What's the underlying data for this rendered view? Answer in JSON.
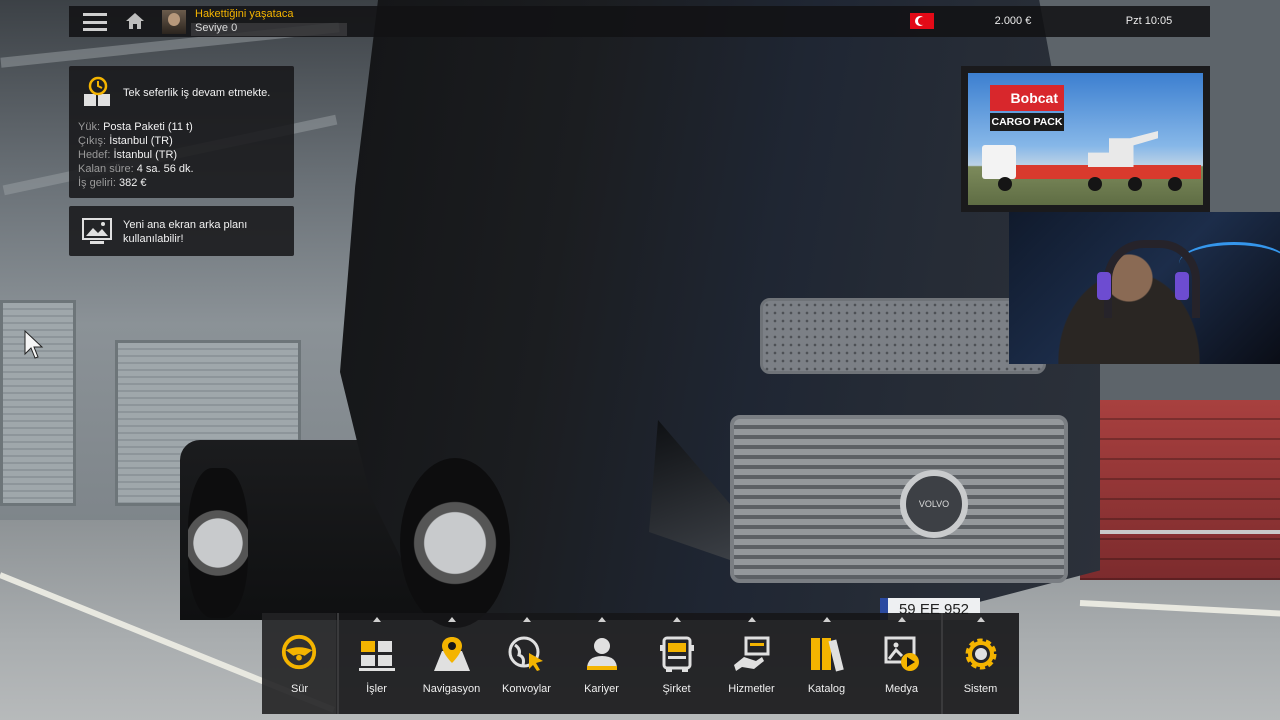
{
  "colors": {
    "accent": "#f4b400",
    "panel_bg": "#161618",
    "text": "#f2f2f2"
  },
  "topbar": {
    "menu_icon": "hamburger-icon",
    "home_icon": "home-icon",
    "player_name": "Hakettiğini yaşataca",
    "player_level": "Seviye 0",
    "flag": "turkey-flag",
    "money": "2.000 €",
    "clock": "Pzt 10:05"
  },
  "job_panel": {
    "icon": "clock-cargo-icon",
    "title": "Tek seferlik iş devam etmekte.",
    "rows": [
      {
        "key": "Yük:",
        "value": "Posta Paketi (11 t)"
      },
      {
        "key": "Çıkış:",
        "value": "İstanbul (TR)"
      },
      {
        "key": "Hedef:",
        "value": "İstanbul (TR)"
      },
      {
        "key": "Kalan süre:",
        "value": "4 sa. 56 dk."
      },
      {
        "key": "İş geliri:",
        "value": "382 €"
      }
    ]
  },
  "background_panel": {
    "icon": "image-icon",
    "text": "Yeni ana ekran arka planı kullanılabilir!"
  },
  "ad": {
    "brand": "Bobcat",
    "subtitle": "CARGO PACK"
  },
  "truck": {
    "plate": "59 EE 952",
    "badge": "VOLVO"
  },
  "nav": [
    {
      "label": "Sür",
      "icon": "steering-wheel-icon"
    },
    {
      "label": "İşler",
      "icon": "cargo-boxes-icon"
    },
    {
      "label": "Navigasyon",
      "icon": "map-pin-icon"
    },
    {
      "label": "Konvoylar",
      "icon": "globe-cursor-icon"
    },
    {
      "label": "Kariyer",
      "icon": "person-icon"
    },
    {
      "label": "Şirket",
      "icon": "truck-front-icon"
    },
    {
      "label": "Hizmetler",
      "icon": "service-hand-icon"
    },
    {
      "label": "Katalog",
      "icon": "books-icon"
    },
    {
      "label": "Medya",
      "icon": "media-icon"
    },
    {
      "label": "Sistem",
      "icon": "gear-icon"
    }
  ]
}
